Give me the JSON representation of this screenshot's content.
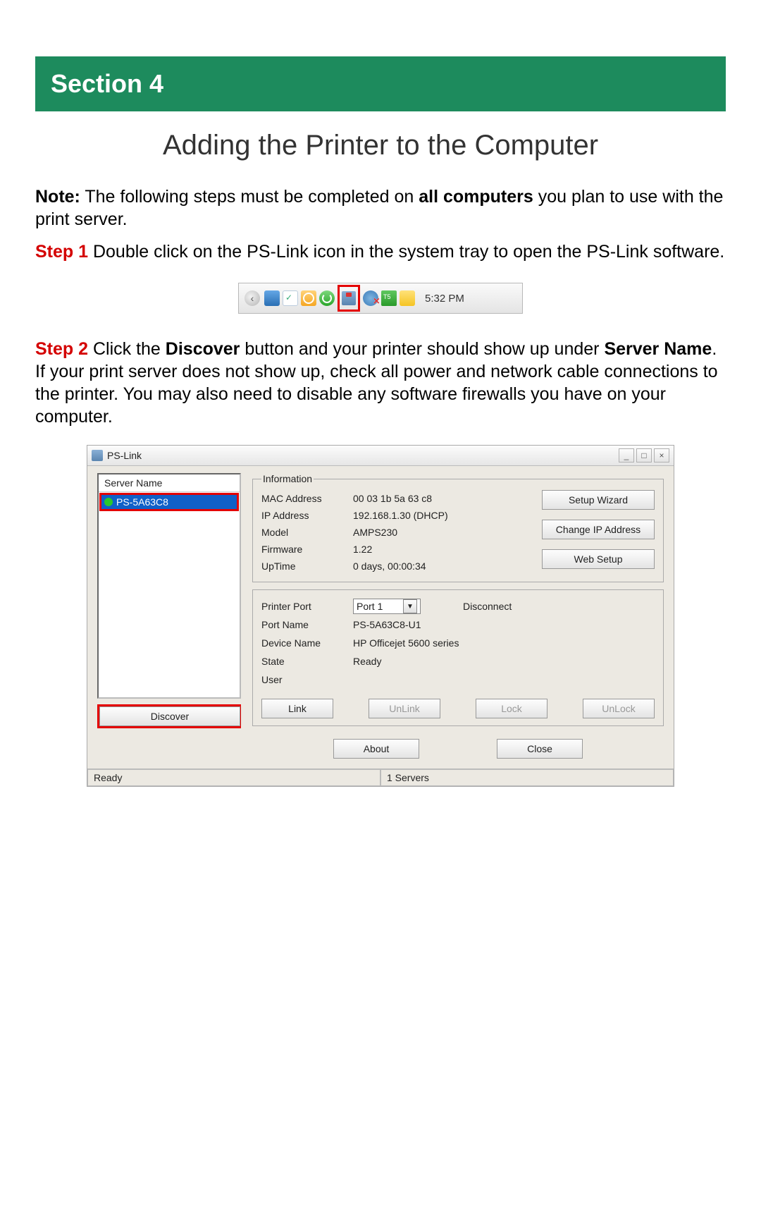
{
  "section_banner": "Section 4",
  "page_title": "Adding the Printer to the Computer",
  "note_label": "Note:",
  "note_text_1": " The following steps must be completed on ",
  "note_bold": "all computers",
  "note_text_2": " you plan to use with the print server.",
  "step1_label": "Step 1",
  "step1_text": " Double click on the PS-Link icon in the system tray to open the PS-Link software.",
  "tray": {
    "time": "5:32 PM"
  },
  "step2_label": "Step 2",
  "step2_text_1": " Click the ",
  "step2_bold_1": "Discover",
  "step2_text_2": " button and your printer should show up under ",
  "step2_bold_2": "Server Name",
  "step2_text_3": ".  If your print server does not show up, check all power and network cable connections to the printer.  You may also need to disable any software firewalls you have on your computer.",
  "window": {
    "title": "PS-Link",
    "server_name_header": "Server Name",
    "server_entry": "PS-5A63C8",
    "discover": "Discover",
    "info_legend": "Information",
    "labels": {
      "mac": "MAC Address",
      "ip": "IP Address",
      "model": "Model",
      "fw": "Firmware",
      "uptime": "UpTime"
    },
    "values": {
      "mac": "00 03 1b 5a 63 c8",
      "ip": "192.168.1.30 (DHCP)",
      "model": "AMPS230",
      "fw": "1.22",
      "uptime": "0 days, 00:00:34"
    },
    "buttons": {
      "setup_wizard": "Setup Wizard",
      "change_ip": "Change IP Address",
      "web_setup": "Web Setup",
      "link": "Link",
      "unlink": "UnLink",
      "lock": "Lock",
      "unlock": "UnLock",
      "about": "About",
      "close": "Close"
    },
    "port": {
      "label": "Printer Port",
      "selected": "Port 1",
      "disconnect": "Disconnect",
      "port_name_l": "Port Name",
      "port_name_v": "PS-5A63C8-U1",
      "device_l": "Device Name",
      "device_v": "HP Officejet 5600 series",
      "state_l": "State",
      "state_v": "Ready",
      "user_l": "User",
      "user_v": ""
    },
    "status": {
      "left": "Ready",
      "right": "1 Servers"
    }
  }
}
